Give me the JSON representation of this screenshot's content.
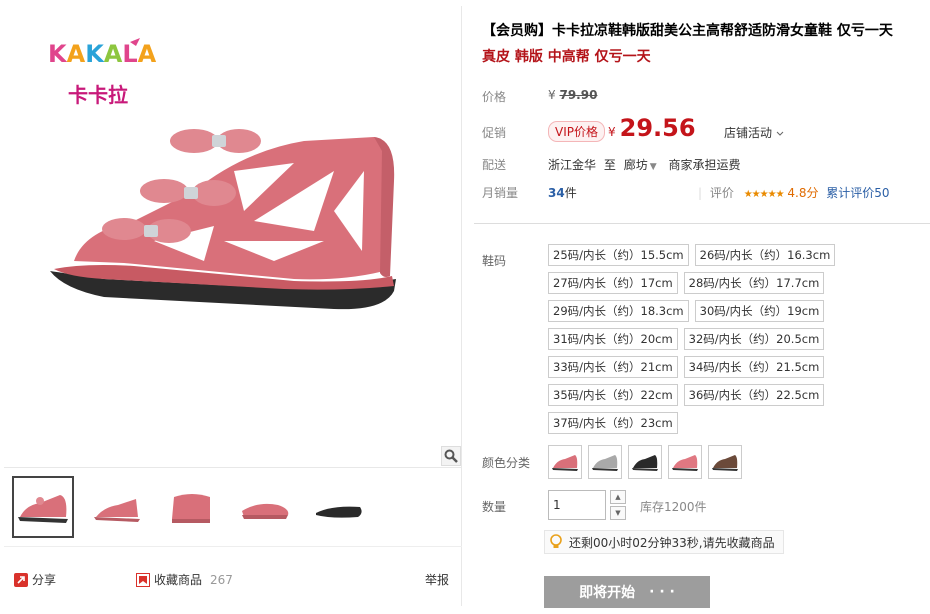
{
  "brand": {
    "name_en": "KAKALA",
    "name_cn": "卡卡拉"
  },
  "product": {
    "title": "【会员购】卡卡拉凉鞋韩版甜美公主高帮舒适防滑女童鞋 仅亏一天",
    "subtitle": "真皮 韩版 中高帮 仅亏一天"
  },
  "price": {
    "label": "价格",
    "currency": "¥",
    "original": "79.90",
    "promo_label": "促销",
    "vip_tag": "VIP价格",
    "promo": "29.56",
    "shop_activity": "店铺活动"
  },
  "shipping": {
    "label": "配送",
    "from": "浙江金华",
    "to_word": "至",
    "to": "廊坊",
    "fee": "商家承担运费"
  },
  "sales": {
    "label": "月销量",
    "count": "34",
    "unit": "件",
    "rating_label": "评价",
    "stars": 4.8,
    "score": "4.8分",
    "review_text": "累计评价50"
  },
  "size": {
    "label": "鞋码",
    "options": [
      "25码/内长（约）15.5cm",
      "26码/内长（约）16.3cm",
      "27码/内长（约）17cm",
      "28码/内长（约）17.7cm",
      "29码/内长（约）18.3cm",
      "30码/内长（约）19cm",
      "31码/内长（约）20cm",
      "32码/内长（约）20.5cm",
      "33码/内长（约）21cm",
      "34码/内长（约）21.5cm",
      "35码/内长（约）22cm",
      "36码/内长（约）22.5cm",
      "37码/内长（约）23cm"
    ]
  },
  "color": {
    "label": "颜色分类",
    "swatches": [
      "#d9707a",
      "#a9a9a9",
      "#2a2a2a",
      "#e07882",
      "#6b4a3a"
    ]
  },
  "quantity": {
    "label": "数量",
    "value": "1",
    "stock": "库存1200件"
  },
  "countdown": "还剩00小时02分钟33秒,请先收藏商品",
  "buy_button": {
    "label": "即将开始",
    "dots": "· · ·"
  },
  "footer": {
    "share": "分享",
    "favorite": "收藏商品",
    "favorite_count": "267",
    "report": "举报"
  },
  "colors": {
    "accent_red": "#c4141a",
    "link_blue": "#2b5fa6",
    "shoe_pink": "#d9707a"
  }
}
